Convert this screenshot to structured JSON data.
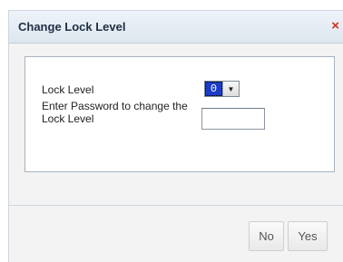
{
  "dialog": {
    "title": "Change Lock Level",
    "close_glyph": "×",
    "close_icon": "close-icon"
  },
  "form": {
    "lock_level_label": "Lock Level",
    "lock_level_value": "0",
    "select_arrow_glyph": "▼",
    "password_label": "Enter Password to change the Lock Level",
    "password_value": ""
  },
  "buttons": {
    "no_label": "No",
    "yes_label": "Yes"
  },
  "colors": {
    "title_text": "#1f2f44",
    "close_icon": "#d62d20",
    "selection": "#1a3cc7"
  }
}
